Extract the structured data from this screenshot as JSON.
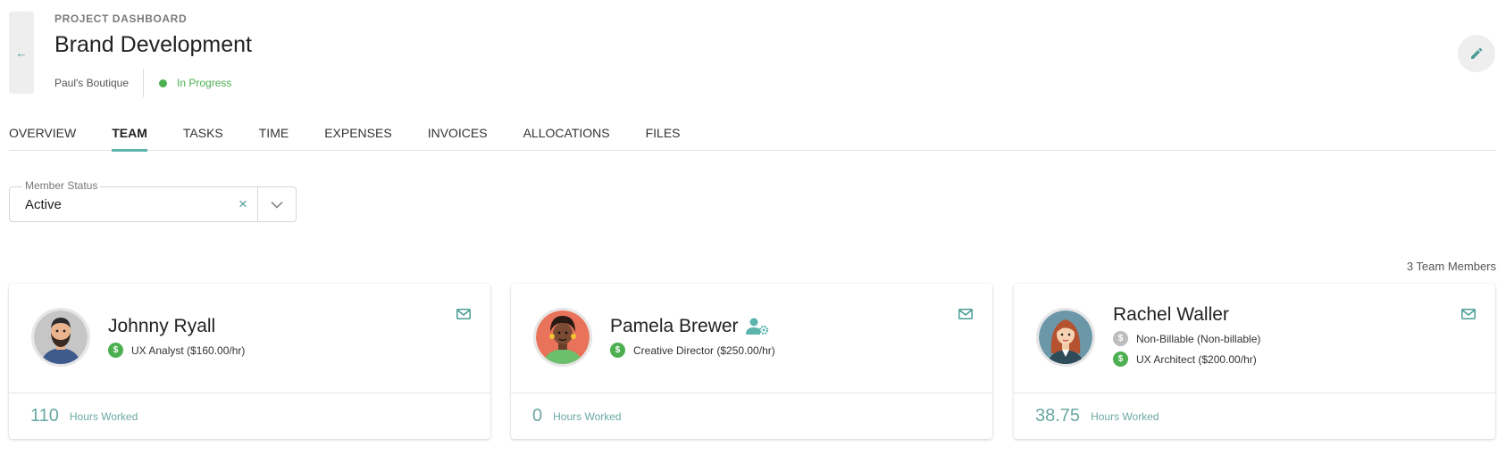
{
  "header": {
    "eyebrow": "PROJECT DASHBOARD",
    "title": "Brand Development",
    "client": "Paul's Boutique",
    "status": "In Progress"
  },
  "tabs": [
    "OVERVIEW",
    "TEAM",
    "TASKS",
    "TIME",
    "EXPENSES",
    "INVOICES",
    "ALLOCATIONS",
    "FILES"
  ],
  "active_tab": "TEAM",
  "filter": {
    "label": "Member Status",
    "value": "Active"
  },
  "team_count": "3 Team Members",
  "members": [
    {
      "name": "Johnny Ryall",
      "roles": [
        {
          "text": "UX Analyst ($160.00/hr)",
          "billable": true
        }
      ],
      "hours": "110",
      "hours_label": "Hours Worked"
    },
    {
      "name": "Pamela Brewer",
      "roles": [
        {
          "text": "Creative Director ($250.00/hr)",
          "billable": true
        }
      ],
      "hours": "0",
      "hours_label": "Hours Worked",
      "manager": true
    },
    {
      "name": "Rachel Waller",
      "roles": [
        {
          "text": "Non-Billable (Non-billable)",
          "billable": false
        },
        {
          "text": "UX Architect ($200.00/hr)",
          "billable": true
        }
      ],
      "hours": "38.75",
      "hours_label": "Hours Worked"
    }
  ],
  "icons": {
    "back": "arrow-left-icon",
    "edit": "pencil-icon",
    "clear": "close-icon",
    "dropdown": "chevron-down-icon",
    "email": "envelope-icon",
    "manager": "user-gear-icon",
    "billable": "dollar-icon"
  },
  "colors": {
    "accent": "#5ab4ac",
    "status_green": "#4caf50",
    "billable_green": "#4caf50",
    "nonbillable_gray": "#bdbdbd",
    "hours_teal": "#6aa8a2"
  }
}
